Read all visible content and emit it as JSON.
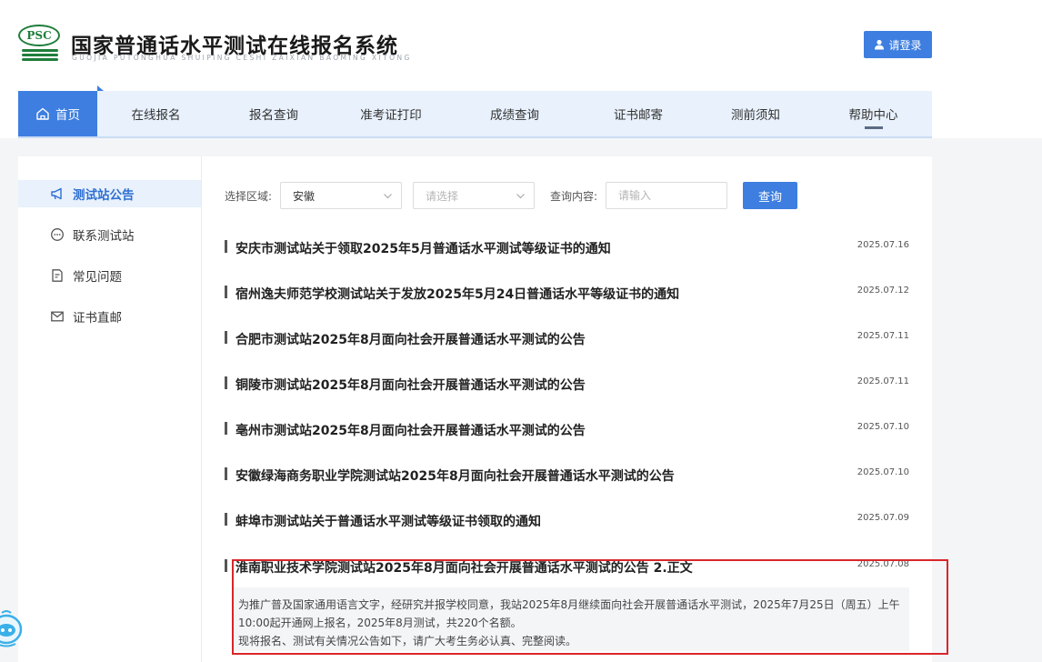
{
  "header": {
    "logo_text": "PSC",
    "title": "国家普通话水平测试在线报名系统",
    "subtitle": "GUOJIA PUTONGHUA SHUIPING CESHI ZAIXIAN BAOMING XITONG",
    "login_label": "请登录"
  },
  "nav": {
    "items": [
      {
        "label": "首页"
      },
      {
        "label": "在线报名"
      },
      {
        "label": "报名查询"
      },
      {
        "label": "准考证打印"
      },
      {
        "label": "成绩查询"
      },
      {
        "label": "证书邮寄"
      },
      {
        "label": "测前须知"
      },
      {
        "label": "帮助中心"
      }
    ]
  },
  "sidebar": {
    "items": [
      {
        "label": "测试站公告"
      },
      {
        "label": "联系测试站"
      },
      {
        "label": "常见问题"
      },
      {
        "label": "证书直邮"
      }
    ]
  },
  "search": {
    "region_label": "选择区域:",
    "province_value": "安徽",
    "city_placeholder": "请选择",
    "content_label": "查询内容:",
    "content_placeholder": "请输入",
    "button_label": "查询"
  },
  "notices": [
    {
      "title": "安庆市测试站关于领取2025年5月普通话水平测试等级证书的通知",
      "date": "2025.07.16"
    },
    {
      "title": "宿州逸夫师范学校测试站关于发放2025年5月24日普通话水平等级证书的通知",
      "date": "2025.07.12"
    },
    {
      "title": "合肥市测试站2025年8月面向社会开展普通话水平测试的公告",
      "date": "2025.07.11"
    },
    {
      "title": "铜陵市测试站2025年8月面向社会开展普通话水平测试的公告",
      "date": "2025.07.11"
    },
    {
      "title": "亳州市测试站2025年8月面向社会开展普通话水平测试的公告",
      "date": "2025.07.10"
    },
    {
      "title": "安徽绿海商务职业学院测试站2025年8月面向社会开展普通话水平测试的公告",
      "date": "2025.07.10"
    },
    {
      "title": "蚌埠市测试站关于普通话水平测试等级证书领取的通知",
      "date": "2025.07.09"
    },
    {
      "title": "淮南职业技术学院测试站2025年8月面向社会开展普通话水平测试的公告 2.正文",
      "date": "2025.07.08"
    }
  ],
  "excerpt": {
    "line1": "为推广普及国家通用语言文字，经研究并报学校同意，我站2025年8月继续面向社会开展普通话水平测试，2025年7月25日（周五）上午",
    "line2": "10:00起开通网上报名，2025年8月测试，共220个名额。",
    "line3": "现将报名、测试有关情况公告如下，请广大考生务必认真、完整阅读。"
  },
  "colors": {
    "primary": "#3d7ee0",
    "nav_bg": "#e8f1fc",
    "logo_green": "#1e7d3a",
    "highlight_red": "#d9262b"
  },
  "icons": [
    "user-icon",
    "home-icon",
    "megaphone-icon",
    "chat-icon",
    "document-icon",
    "mail-icon",
    "chevron-down-icon",
    "robot-assistant-icon"
  ]
}
